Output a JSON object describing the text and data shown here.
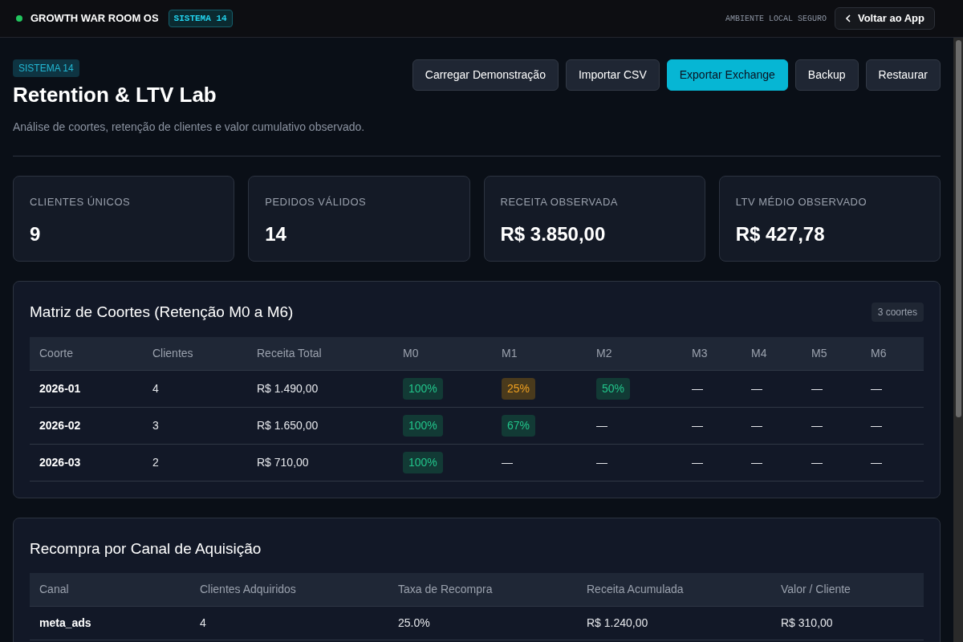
{
  "topbar": {
    "title": "GROWTH WAR ROOM OS",
    "badge": "SISTEMA 14",
    "environment": "AMBIENTE LOCAL SEGURO",
    "back_button": "Voltar ao App"
  },
  "header": {
    "tag": "SISTEMA 14",
    "title": "Retention & LTV Lab",
    "subtitle": "Análise de coortes, retenção de clientes e valor cumulativo observado.",
    "actions": [
      {
        "label": "Carregar Demonstração",
        "primary": false
      },
      {
        "label": "Importar CSV",
        "primary": false
      },
      {
        "label": "Exportar Exchange",
        "primary": true
      },
      {
        "label": "Backup",
        "primary": false
      },
      {
        "label": "Restaurar",
        "primary": false
      }
    ]
  },
  "stats": [
    {
      "label": "CLIENTES ÚNICOS",
      "value": "9"
    },
    {
      "label": "PEDIDOS VÁLIDOS",
      "value": "14"
    },
    {
      "label": "RECEITA OBSERVADA",
      "value": "R$ 3.850,00"
    },
    {
      "label": "LTV MÉDIO OBSERVADO",
      "value": "R$ 427,78"
    }
  ],
  "cohort_matrix": {
    "title": "Matriz de Coortes (Retenção M0 a M6)",
    "count": "3 coortes",
    "columns": [
      "Coorte",
      "Clientes",
      "Receita Total",
      "M0",
      "M1",
      "M2",
      "M3",
      "M4",
      "M5",
      "M6"
    ],
    "rows": [
      {
        "cells": [
          {
            "text": "2026-01",
            "kind": "key"
          },
          {
            "text": "4",
            "kind": "plain"
          },
          {
            "text": "R$ 1.490,00",
            "kind": "plain"
          },
          {
            "text": "100%",
            "kind": "good"
          },
          {
            "text": "25%",
            "kind": "warn"
          },
          {
            "text": "50%",
            "kind": "good"
          },
          {
            "text": "—",
            "kind": "plain"
          },
          {
            "text": "—",
            "kind": "plain"
          },
          {
            "text": "—",
            "kind": "plain"
          },
          {
            "text": "—",
            "kind": "plain"
          }
        ]
      },
      {
        "cells": [
          {
            "text": "2026-02",
            "kind": "key"
          },
          {
            "text": "3",
            "kind": "plain"
          },
          {
            "text": "R$ 1.650,00",
            "kind": "plain"
          },
          {
            "text": "100%",
            "kind": "good"
          },
          {
            "text": "67%",
            "kind": "good"
          },
          {
            "text": "—",
            "kind": "plain"
          },
          {
            "text": "—",
            "kind": "plain"
          },
          {
            "text": "—",
            "kind": "plain"
          },
          {
            "text": "—",
            "kind": "plain"
          },
          {
            "text": "—",
            "kind": "plain"
          }
        ]
      },
      {
        "cells": [
          {
            "text": "2026-03",
            "kind": "key"
          },
          {
            "text": "2",
            "kind": "plain"
          },
          {
            "text": "R$ 710,00",
            "kind": "plain"
          },
          {
            "text": "100%",
            "kind": "good"
          },
          {
            "text": "—",
            "kind": "plain"
          },
          {
            "text": "—",
            "kind": "plain"
          },
          {
            "text": "—",
            "kind": "plain"
          },
          {
            "text": "—",
            "kind": "plain"
          },
          {
            "text": "—",
            "kind": "plain"
          },
          {
            "text": "—",
            "kind": "plain"
          }
        ]
      }
    ]
  },
  "channel_repurchase": {
    "title": "Recompra por Canal de Aquisição",
    "columns": [
      "Canal",
      "Clientes Adquiridos",
      "Taxa de Recompra",
      "Receita Acumulada",
      "Valor / Cliente"
    ],
    "rows": [
      [
        "meta_ads",
        "4",
        "25.0%",
        "R$ 1.240,00",
        "R$ 310,00"
      ]
    ]
  }
}
